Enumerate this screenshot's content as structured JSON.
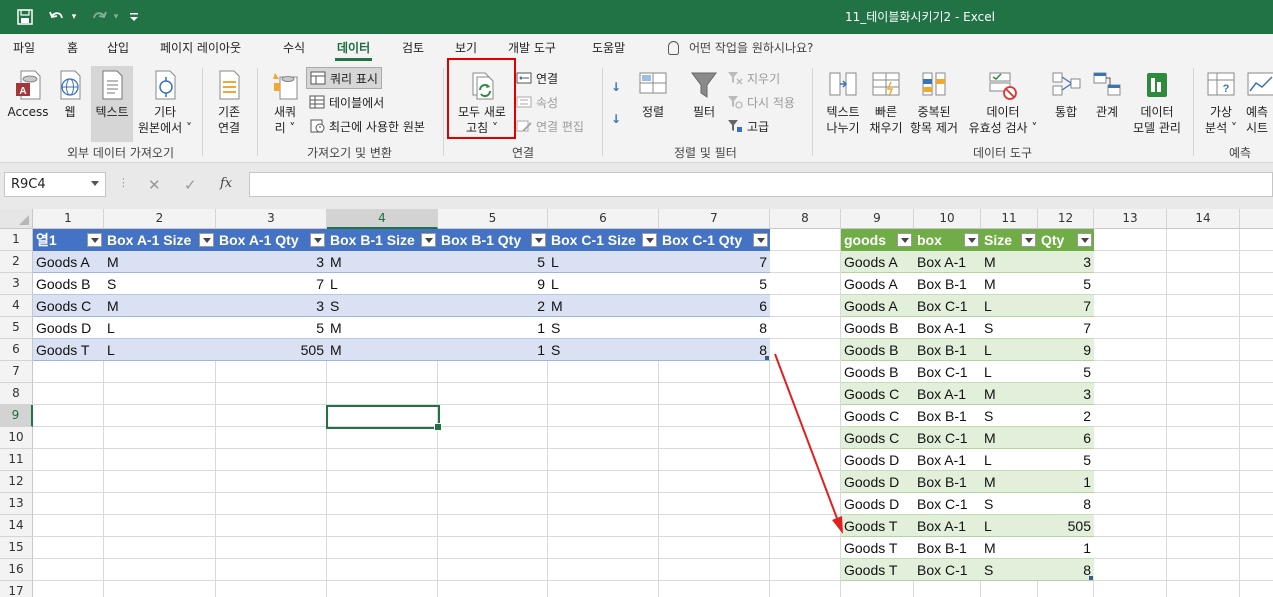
{
  "title_bar": {
    "title": "11_테이블화시키기2  -  Excel",
    "save_icon": "save-icon",
    "undo_icon": "undo-icon",
    "redo_icon": "redo-icon",
    "customize_icon": "customize-quick-access-icon"
  },
  "menu": {
    "tabs": [
      "파일",
      "홈",
      "삽입",
      "페이지 레이아웃",
      "수식",
      "데이터",
      "검토",
      "보기",
      "개발 도구",
      "도움말"
    ],
    "active_tab": "데이터",
    "tell_me": "어떤 작업을 원하시나요?"
  },
  "ribbon": {
    "external": {
      "access": "Access",
      "web": "웹",
      "text": "텍스트",
      "other_line1": "기타",
      "other_line2": "원본에서 ˅",
      "label": "외부 데이터 가져오기"
    },
    "existing_line1": "기존",
    "existing_line2": "연결",
    "getdata": {
      "new_query_line1": "새쿼",
      "new_query_line2": "리 ˅",
      "show_queries": "쿼리 표시",
      "from_table": "테이블에서",
      "recent_sources": "최근에 사용한 원본",
      "label": "가져오기 및 변환"
    },
    "connections": {
      "refresh_line1": "모두 새로",
      "refresh_line2": "고침 ˅",
      "connections": "연결",
      "properties": "속성",
      "edit_links": "연결 편집",
      "label": "연결"
    },
    "sort": {
      "sort": "정렬",
      "filter": "필터",
      "clear": "지우기",
      "reapply": "다시 적용",
      "advanced": "고급",
      "label": "정렬 및 필터"
    },
    "tools": {
      "text_to_columns_line1": "텍스트",
      "text_to_columns_line2": "나누기",
      "flash_fill_line1": "빠른",
      "flash_fill_line2": "채우기",
      "remove_dup_line1": "중복된",
      "remove_dup_line2": "항목 제거",
      "validation_line1": "데이터",
      "validation_line2": "유효성 검사 ˅",
      "consolidate": "통합",
      "relationships": "관계",
      "data_model_line1": "데이터",
      "data_model_line2": "모델 관리",
      "label": "데이터 도구"
    },
    "forecast": {
      "whatif_line1": "가상",
      "whatif_line2": "분석 ˅",
      "sheet_line1": "예측",
      "sheet_line2": "시트",
      "label": "예측"
    }
  },
  "formula_bar": {
    "name_box": "R9C4",
    "cancel_icon": "✕",
    "enter_icon": "✓",
    "fx_label": "fx",
    "value": ""
  },
  "grid": {
    "columns": [
      "1",
      "2",
      "3",
      "4",
      "5",
      "6",
      "7",
      "8",
      "9",
      "10",
      "11",
      "12",
      "13",
      "14",
      "1"
    ],
    "rows": [
      "1",
      "2",
      "3",
      "4",
      "5",
      "6",
      "7",
      "8",
      "9",
      "10",
      "11",
      "12",
      "13",
      "14",
      "15",
      "16",
      "17"
    ],
    "selected_column": "4",
    "selected_row": "9",
    "table1": {
      "headers": [
        "열1",
        "Box A-1 Size",
        "Box A-1 Qty",
        "Box B-1 Size",
        "Box B-1 Qty",
        "Box C-1 Size",
        "Box C-1 Qty"
      ],
      "rows": [
        [
          "Goods A",
          "M",
          "3",
          "M",
          "5",
          "L",
          "7"
        ],
        [
          "Goods B",
          "S",
          "7",
          "L",
          "9",
          "L",
          "5"
        ],
        [
          "Goods C",
          "M",
          "3",
          "S",
          "2",
          "M",
          "6"
        ],
        [
          "Goods D",
          "L",
          "5",
          "M",
          "1",
          "S",
          "8"
        ],
        [
          "Goods T",
          "L",
          "505",
          "M",
          "1",
          "S",
          "8"
        ]
      ],
      "header_color": "#4472c4",
      "band_color": "#d9e1f2"
    },
    "table2": {
      "headers": [
        "goods",
        "box",
        "Size",
        "Qty"
      ],
      "rows": [
        [
          "Goods A",
          "Box A-1",
          "M",
          "3"
        ],
        [
          "Goods A",
          "Box B-1",
          "M",
          "5"
        ],
        [
          "Goods A",
          "Box C-1",
          "L",
          "7"
        ],
        [
          "Goods B",
          "Box A-1",
          "S",
          "7"
        ],
        [
          "Goods B",
          "Box B-1",
          "L",
          "9"
        ],
        [
          "Goods B",
          "Box C-1",
          "L",
          "5"
        ],
        [
          "Goods C",
          "Box A-1",
          "M",
          "3"
        ],
        [
          "Goods C",
          "Box B-1",
          "S",
          "2"
        ],
        [
          "Goods C",
          "Box C-1",
          "M",
          "6"
        ],
        [
          "Goods D",
          "Box A-1",
          "L",
          "5"
        ],
        [
          "Goods D",
          "Box B-1",
          "M",
          "1"
        ],
        [
          "Goods D",
          "Box C-1",
          "S",
          "8"
        ],
        [
          "Goods T",
          "Box A-1",
          "L",
          "505"
        ],
        [
          "Goods T",
          "Box B-1",
          "M",
          "1"
        ],
        [
          "Goods T",
          "Box C-1",
          "S",
          "8"
        ]
      ],
      "header_color": "#70ad47",
      "band_color": "#e2efda"
    }
  },
  "colors": {
    "excel_green": "#217346",
    "highlight_red": "#e00000",
    "arrow_red": "#e02020"
  }
}
